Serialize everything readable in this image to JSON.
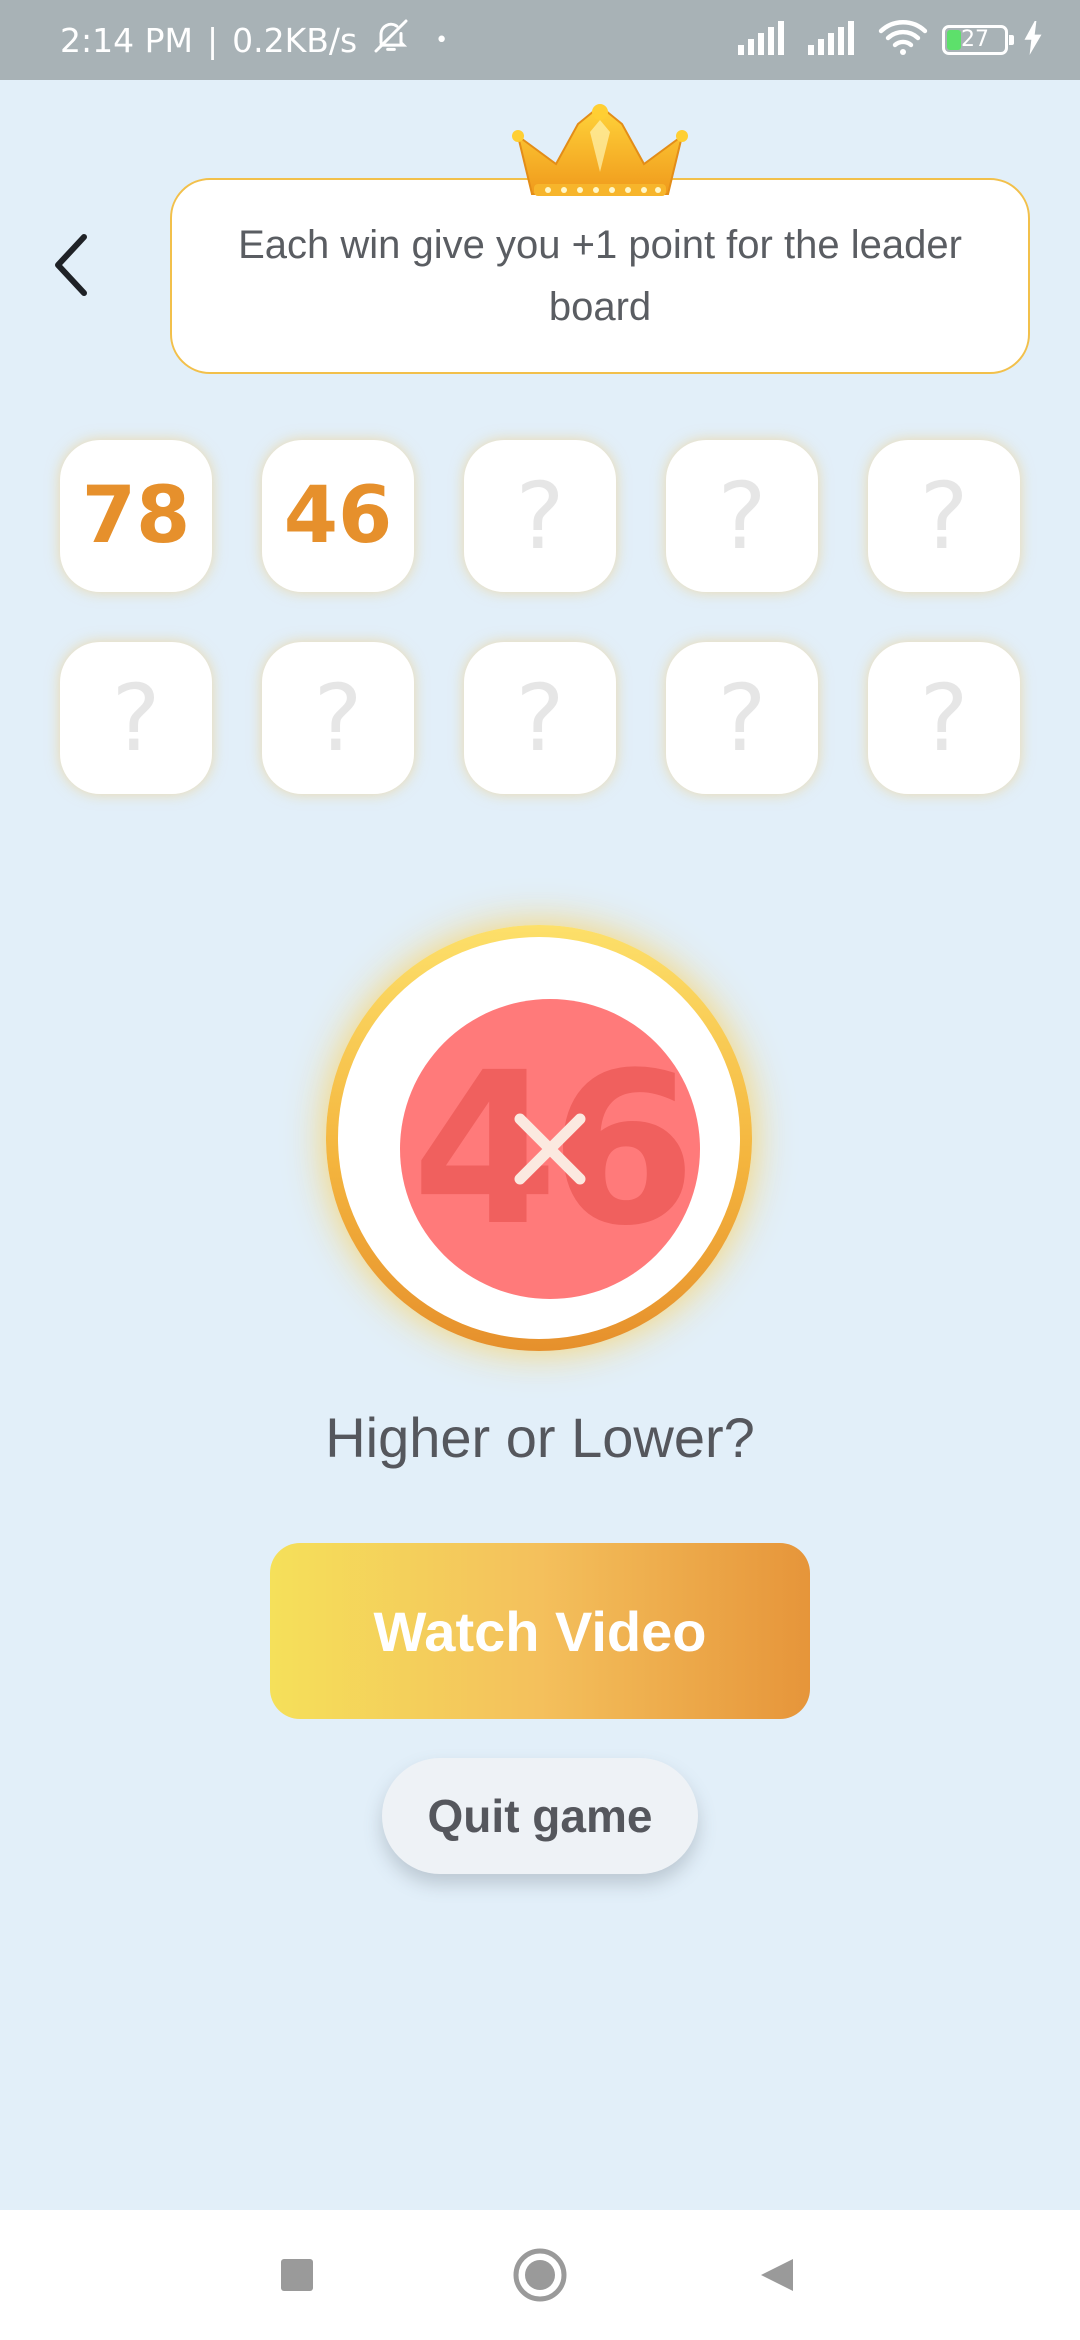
{
  "status_bar": {
    "time": "2:14 PM",
    "separator": "|",
    "speed": "0.2KB/s",
    "dot": "•",
    "battery_level": "27",
    "icons": [
      "bell-muted-icon",
      "signal-icon",
      "signal-icon",
      "wifi-icon",
      "battery-icon",
      "charging-icon"
    ]
  },
  "header": {
    "back_icon": "back-arrow-icon",
    "crown_icon": "crown-icon",
    "info_text": "Each win give you +1 point for the leader board"
  },
  "cards": [
    {
      "value": "78",
      "revealed": true
    },
    {
      "value": "46",
      "revealed": true
    },
    {
      "value": "?",
      "revealed": false
    },
    {
      "value": "?",
      "revealed": false
    },
    {
      "value": "?",
      "revealed": false
    },
    {
      "value": "?",
      "revealed": false
    },
    {
      "value": "?",
      "revealed": false
    },
    {
      "value": "?",
      "revealed": false
    },
    {
      "value": "?",
      "revealed": false
    },
    {
      "value": "?",
      "revealed": false
    }
  ],
  "result": {
    "number": "46",
    "status_icon": "close-icon",
    "colors": {
      "disc": "#ff7a7a",
      "ring": "#f4b53e"
    }
  },
  "question": "Higher or Lower?",
  "buttons": {
    "watch_video": "Watch Video",
    "quit_game": "Quit game"
  },
  "nav_bar": {
    "icons": [
      "recents-square-icon",
      "home-circle-icon",
      "back-triangle-icon"
    ]
  },
  "colors": {
    "background": "#e2eff9",
    "accent_orange": "#e6902c",
    "accent_yellow": "#f5e05a",
    "text_gray": "#55575d"
  }
}
